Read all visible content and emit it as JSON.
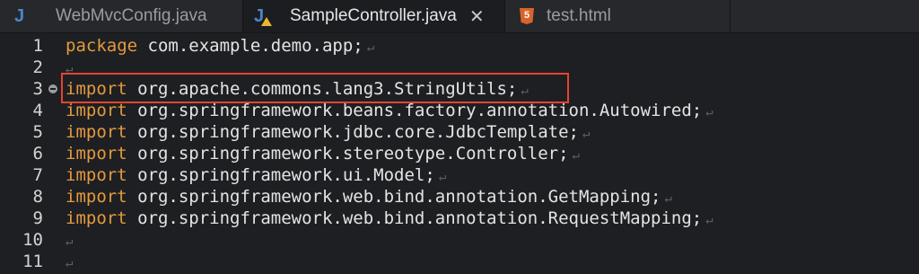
{
  "tabs": [
    {
      "label": "WebMvcConfig.java",
      "icon": "java-icon",
      "active": false
    },
    {
      "label": "SampleController.java",
      "icon": "java-warning-icon",
      "active": true
    },
    {
      "label": "test.html",
      "icon": "html5-icon",
      "active": false
    }
  ],
  "icons": {
    "java": "J",
    "html5": "5",
    "close": "✕"
  },
  "eol_marker": "↵",
  "lines": [
    {
      "num": "1",
      "kw": "package",
      "rest": " com.example.demo.app;"
    },
    {
      "num": "2",
      "kw": "",
      "rest": ""
    },
    {
      "num": "3",
      "kw": "import",
      "rest": " org.apache.commons.lang3.StringUtils;"
    },
    {
      "num": "4",
      "kw": "import",
      "rest": " org.springframework.beans.factory.annotation.Autowired;"
    },
    {
      "num": "5",
      "kw": "import",
      "rest": " org.springframework.jdbc.core.JdbcTemplate;"
    },
    {
      "num": "6",
      "kw": "import",
      "rest": " org.springframework.stereotype.Controller;"
    },
    {
      "num": "7",
      "kw": "import",
      "rest": " org.springframework.ui.Model;"
    },
    {
      "num": "8",
      "kw": "import",
      "rest": " org.springframework.web.bind.annotation.GetMapping;"
    },
    {
      "num": "9",
      "kw": "import",
      "rest": " org.springframework.web.bind.annotation.RequestMapping;"
    },
    {
      "num": "10",
      "kw": "",
      "rest": ""
    },
    {
      "num": "11",
      "kw": "",
      "rest": ""
    }
  ],
  "colors": {
    "keyword": "#e39a3e",
    "highlight_box": "#e5442f",
    "background": "#1e1f22"
  }
}
